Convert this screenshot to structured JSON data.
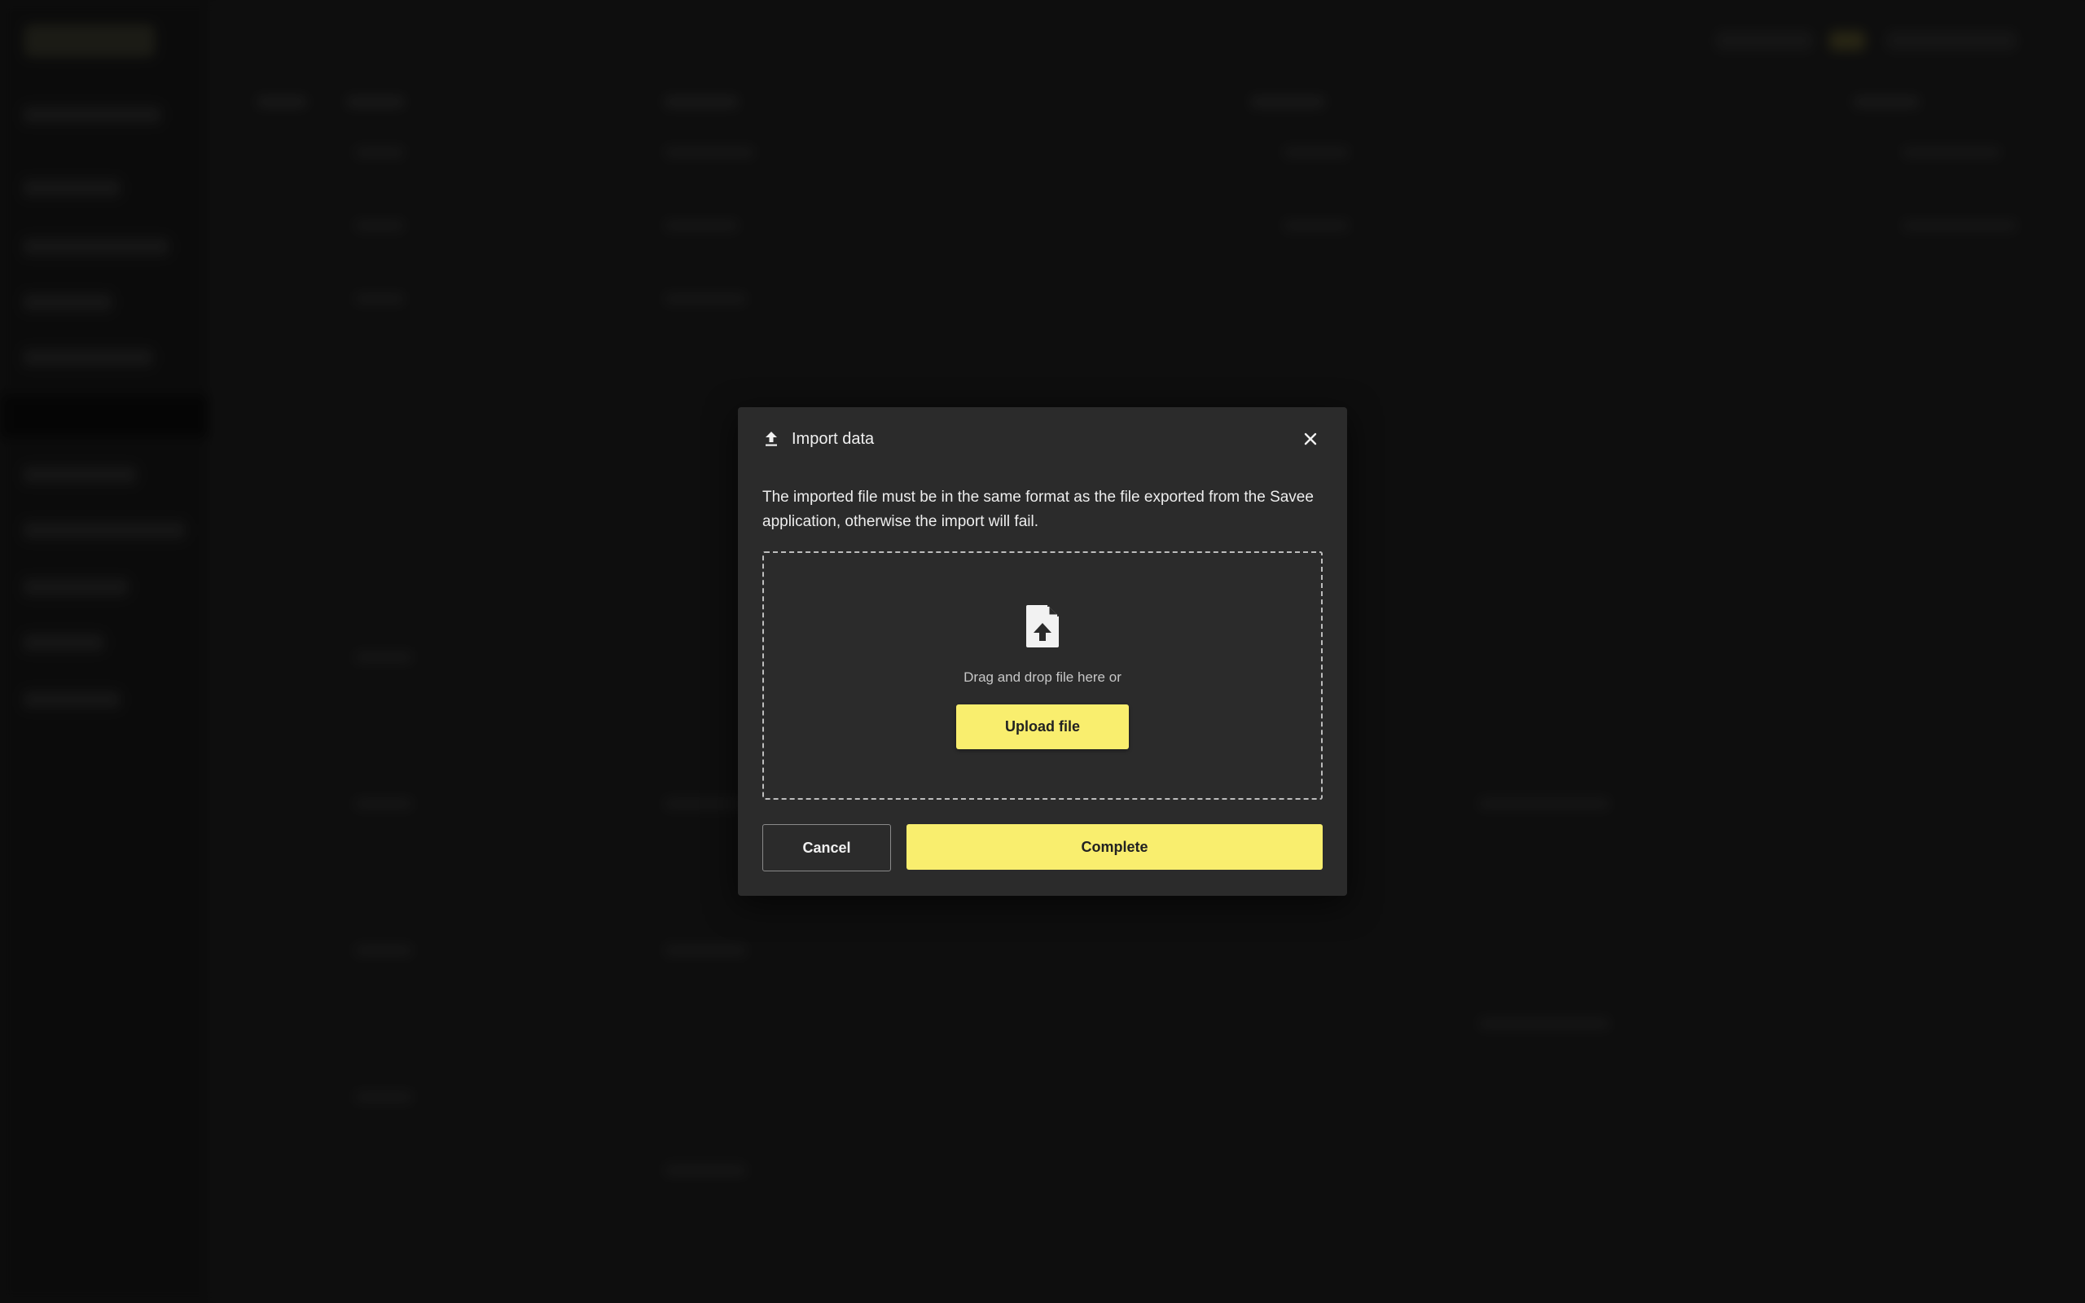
{
  "modal": {
    "title": "Import data",
    "header_icon": "upload-icon",
    "close_icon": "close-icon",
    "description": "The imported file must be in the same format as the file exported from the Savee application, otherwise the import will fail.",
    "dropzone": {
      "icon": "file-upload-icon",
      "text": "Drag and drop file here or",
      "upload_label": "Upload file"
    },
    "cancel_label": "Cancel",
    "complete_label": "Complete"
  },
  "colors": {
    "accent": "#f9ee6e",
    "modal_bg": "#2b2b2b",
    "page_bg": "#141414"
  }
}
